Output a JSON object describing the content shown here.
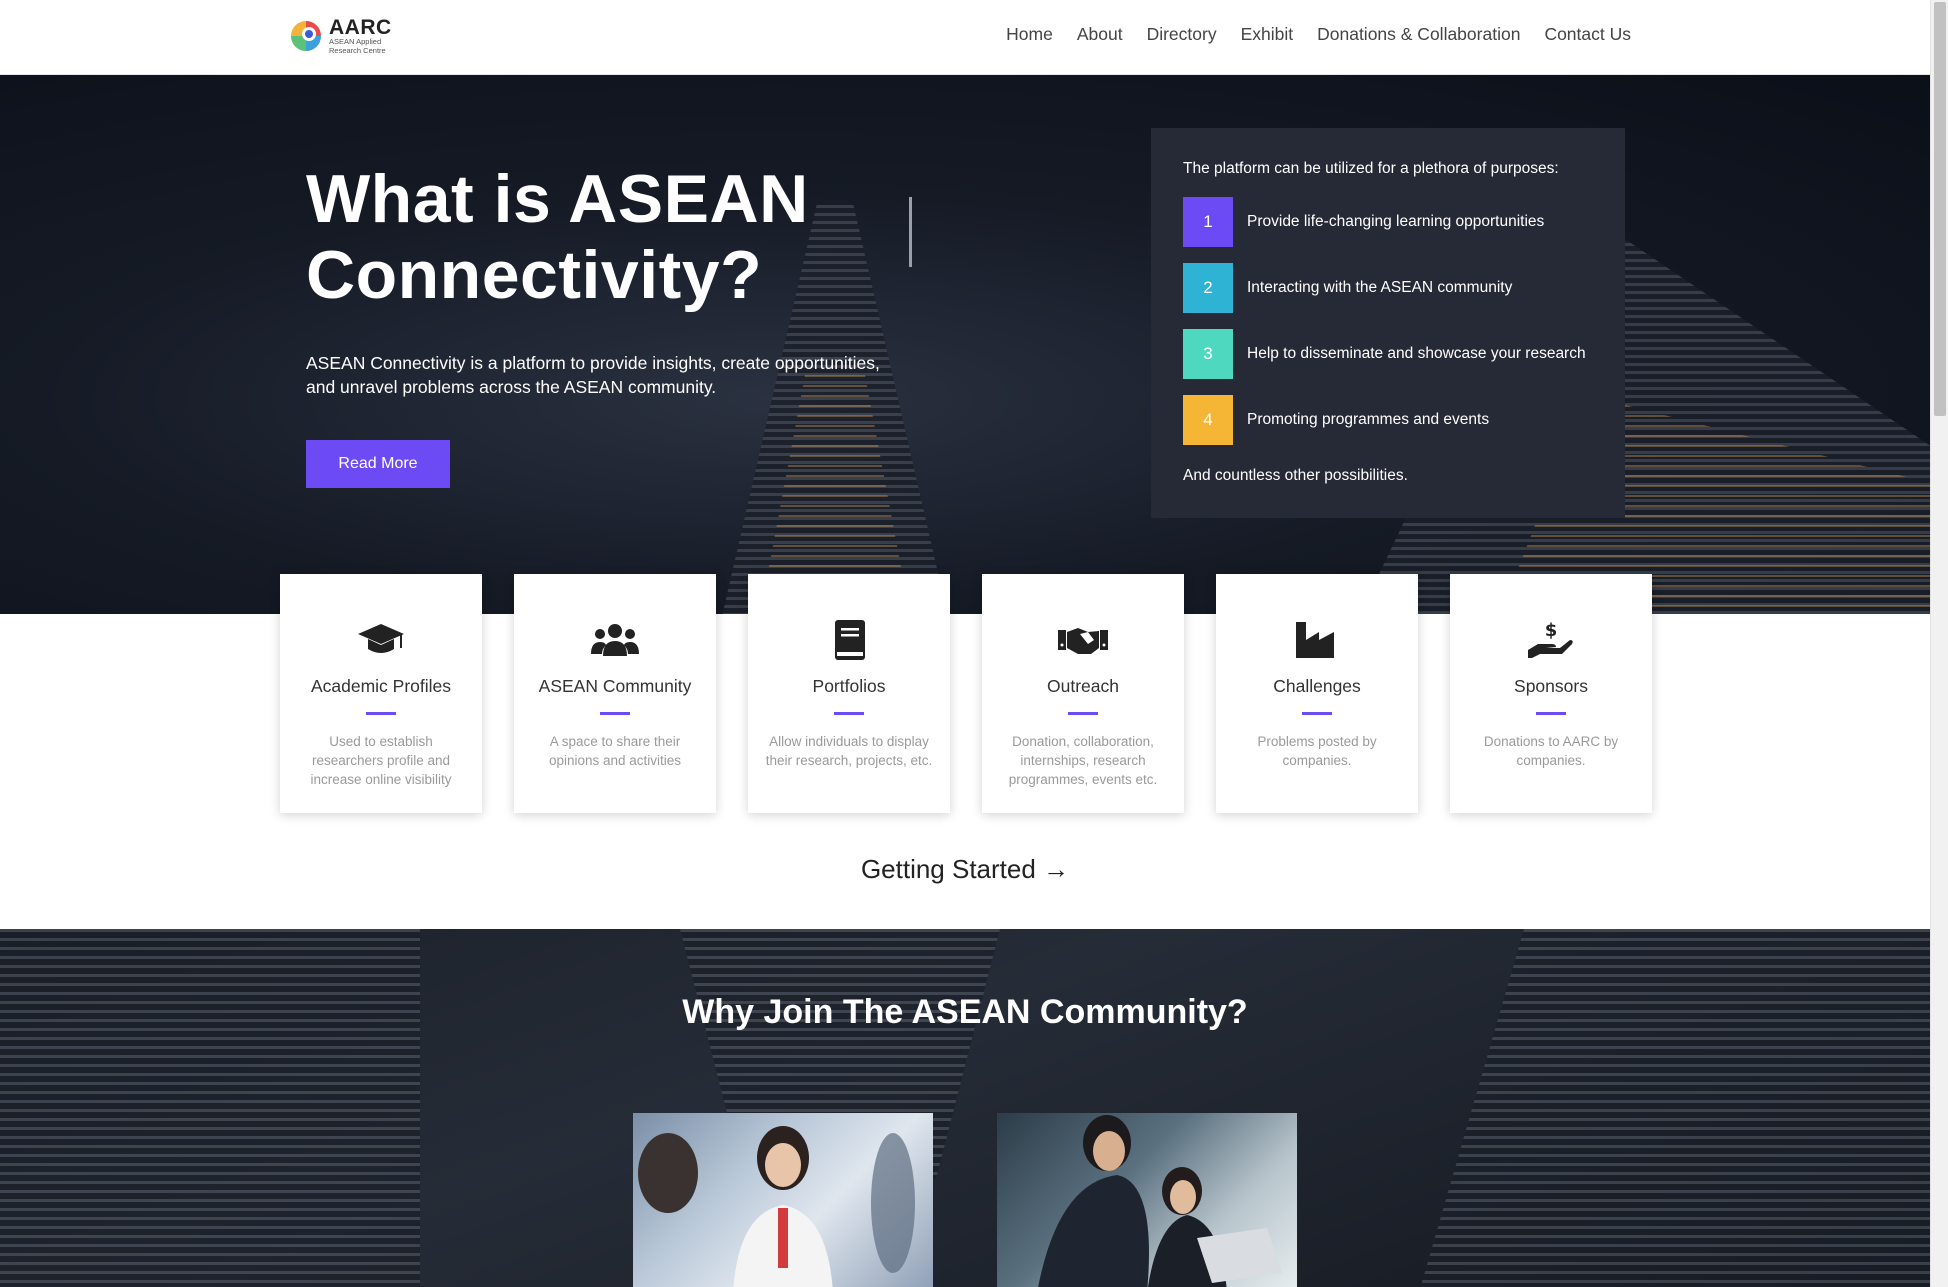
{
  "header": {
    "logo_title": "AARC",
    "logo_subtitle": "ASEAN Applied Research Centre",
    "nav": [
      "Home",
      "About",
      "Directory",
      "Exhibit",
      "Donations & Collaboration",
      "Contact Us"
    ]
  },
  "hero": {
    "title": "What is ASEAN Connectivity?",
    "description": "ASEAN Connectivity is a platform to provide insights, create opportunities, and unravel problems across the ASEAN community.",
    "button": "Read More"
  },
  "purposes": {
    "intro": "The platform can be utilized for a plethora of purposes:",
    "items": [
      {
        "num": "1",
        "label": "Provide life-changing learning opportunities",
        "color": "#6c4bf5"
      },
      {
        "num": "2",
        "label": "Interacting with the ASEAN community",
        "color": "#2fb3d4"
      },
      {
        "num": "3",
        "label": "Help to disseminate and showcase your research",
        "color": "#4fd8c0"
      },
      {
        "num": "4",
        "label": "Promoting programmes and events",
        "color": "#f5b535"
      }
    ],
    "outro": "And countless other possibilities."
  },
  "cards": [
    {
      "icon": "graduation-cap-icon",
      "title": "Academic Profiles",
      "desc": "Used to establish researchers profile and increase online visibility"
    },
    {
      "icon": "users-icon",
      "title": "ASEAN Community",
      "desc": "A space to share their opinions and activities"
    },
    {
      "icon": "book-icon",
      "title": "Portfolios",
      "desc": "Allow individuals to display their research, projects, etc."
    },
    {
      "icon": "handshake-icon",
      "title": "Outreach",
      "desc": "Donation, collaboration, internships, research programmes, events etc."
    },
    {
      "icon": "industry-icon",
      "title": "Challenges",
      "desc": "Problems posted by companies."
    },
    {
      "icon": "donate-hand-icon",
      "title": "Sponsors",
      "desc": "Donations to AARC by companies."
    }
  ],
  "getting_started": "Getting Started →",
  "why": {
    "title": "Why Join The ASEAN Community?"
  },
  "colors": {
    "accent": "#6c4bf5"
  }
}
